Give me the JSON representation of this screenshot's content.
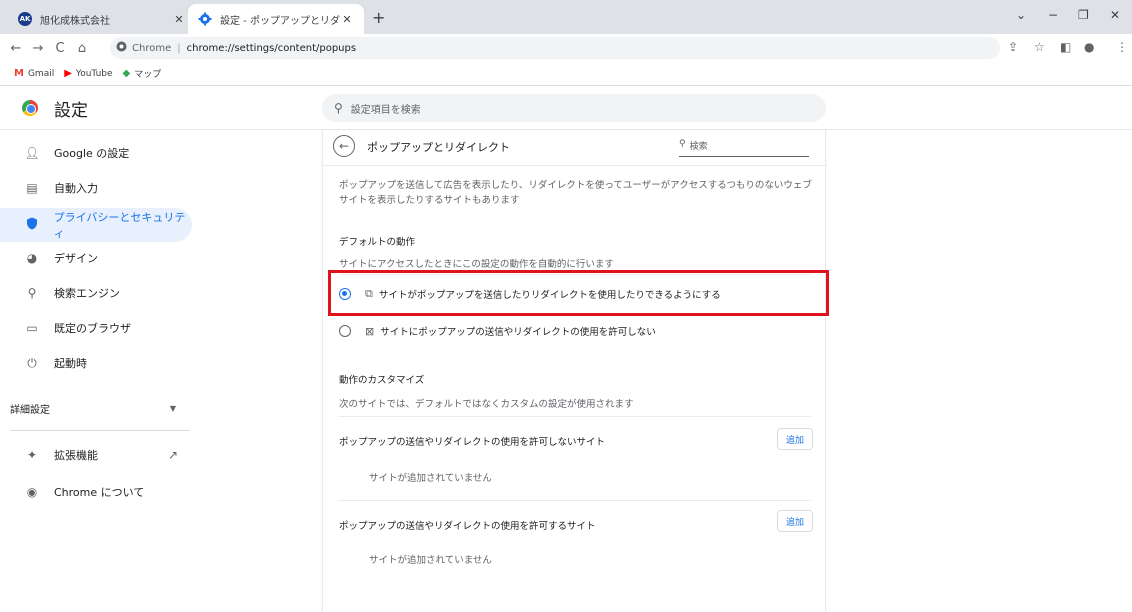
{
  "tabs": [
    {
      "title": "旭化成株式会社",
      "icon": "company-ak-icon",
      "badge": "AK",
      "active": false
    },
    {
      "title": "設定 - ポップアップとリダイレクト",
      "icon": "settings-gear-icon",
      "active": true
    }
  ],
  "toolbar": {
    "site_name": "Chrome",
    "url": "chrome://settings/content/popups"
  },
  "bookmarks": [
    {
      "label": "Gmail",
      "icon": "gmail-icon"
    },
    {
      "label": "YouTube",
      "icon": "youtube-icon"
    },
    {
      "label": "マップ",
      "icon": "maps-icon"
    }
  ],
  "header": {
    "title": "設定",
    "search_placeholder": "設定項目を検索"
  },
  "sidebar": {
    "items": [
      {
        "label": "Google の設定",
        "icon": "person-icon"
      },
      {
        "label": "自動入力",
        "icon": "clipboard-icon"
      },
      {
        "label": "プライバシーとセキュリティ",
        "icon": "shield-icon",
        "selected": true
      },
      {
        "label": "デザイン",
        "icon": "palette-icon"
      },
      {
        "label": "検索エンジン",
        "icon": "search-icon"
      },
      {
        "label": "既定のブラウザ",
        "icon": "browser-window-icon"
      },
      {
        "label": "起動時",
        "icon": "power-icon"
      }
    ],
    "advanced_label": "詳細設定",
    "extensions_label": "拡張機能",
    "about_label": "Chrome について"
  },
  "page": {
    "title": "ポップアップとリダイレクト",
    "search_placeholder": "検索",
    "description": "ポップアップを送信して広告を表示したり、リダイレクトを使ってユーザーがアクセスするつもりのないウェブサイトを表示したりするサイトもあります",
    "default_behavior_label": "デフォルトの動作",
    "default_behavior_sub": "サイトにアクセスしたときにこの設定の動作を自動的に行います",
    "options": [
      {
        "label": "サイトがポップアップを送信したりリダイレクトを使用したりできるようにする",
        "checked": true,
        "icon": "open-external-icon"
      },
      {
        "label": "サイトにポップアップの送信やリダイレクトの使用を許可しない",
        "checked": false,
        "icon": "blocked-popup-icon"
      }
    ],
    "customize_label": "動作のカスタマイズ",
    "customize_sub": "次のサイトでは、デフォルトではなくカスタムの設定が使用されます",
    "block_list_label": "ポップアップの送信やリダイレクトの使用を許可しないサイト",
    "allow_list_label": "ポップアップの送信やリダイレクトの使用を許可するサイト",
    "add_label": "追加",
    "empty_label": "サイトが追加されていません"
  },
  "colors": {
    "accent": "#1a73e8",
    "highlight": "#e0131c"
  }
}
